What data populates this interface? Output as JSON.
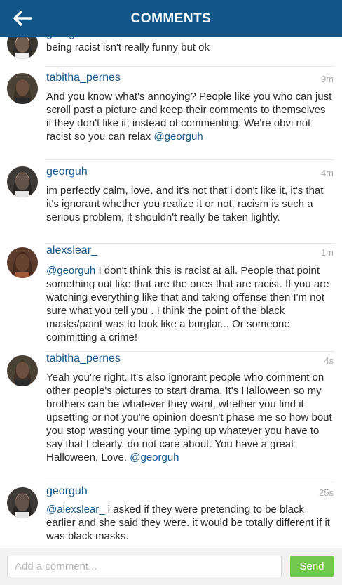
{
  "header": {
    "title": "COMMENTS",
    "back_icon": "arrow-left-icon"
  },
  "colors": {
    "header_bg": "#125688",
    "username": "#125688",
    "send_bg": "#71c94b"
  },
  "comments": [
    {
      "username": "georguh",
      "time": "",
      "text": [
        {
          "t": "being racist isn't really funny but ok"
        }
      ]
    },
    {
      "username": "tabitha_pernes",
      "time": "9m",
      "text": [
        {
          "t": "And you know what's annoying? People like you who can just scroll past a picture and keep their comments to themselves if they don't like it, instead of commenting. We're obvi not racist so you can relax "
        },
        {
          "t": "@georguh",
          "mention": true
        }
      ]
    },
    {
      "username": "georguh",
      "time": "4m",
      "text": [
        {
          "t": "im perfectly calm, love. and it's not that i don't like it, it's that it's ignorant whether you realize it or not. racism is such a serious problem, it shouldn't really be taken lightly."
        }
      ]
    },
    {
      "username": "alexslear_",
      "time": "1m",
      "text": [
        {
          "t": "@georguh",
          "mention": true
        },
        {
          "t": " I don't think this is racist at all. People that point something out like that are the ones that are racist. If you are watching everything like that and taking offense then I'm not sure what you tell you . I think the point of the black masks/paint was to look like a burglar... Or someone committing a crime!"
        }
      ]
    },
    {
      "username": "tabitha_pernes",
      "time": "4s",
      "text": [
        {
          "t": "Yeah you're right. It's also ignorant people who comment on other people's pictures to start drama. It's Halloween so my brothers can be whatever they want, whether you find it upsetting or not you're opinion doesn't phase me so how bout you stop wasting your time typing up whatever you have to say that I clearly, do not care about. You have a great Halloween, Love. "
        },
        {
          "t": "@georguh",
          "mention": true
        }
      ]
    },
    {
      "username": "georguh",
      "time": "25s",
      "text": [
        {
          "t": "@alexslear_",
          "mention": true
        },
        {
          "t": " i asked if they were pretending to be black earlier and she said they were. it would be totally different if it was black masks."
        }
      ]
    }
  ],
  "footer": {
    "placeholder": "Add a comment...",
    "send_label": "Send"
  }
}
